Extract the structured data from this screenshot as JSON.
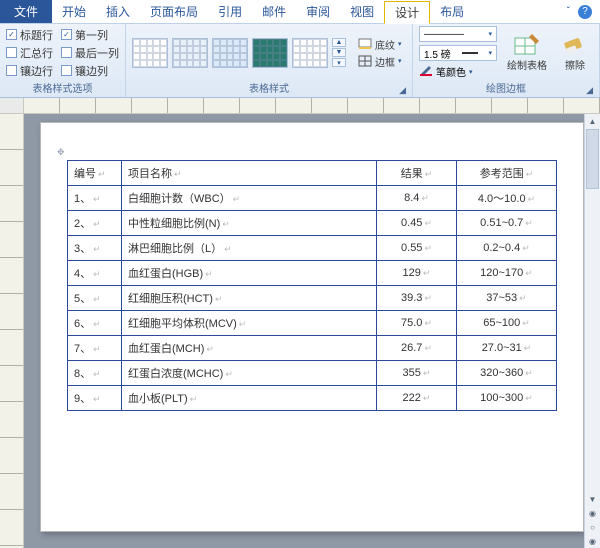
{
  "tabs": {
    "file": "文件",
    "items": [
      "开始",
      "插入",
      "页面布局",
      "引用",
      "邮件",
      "审阅",
      "视图",
      "设计",
      "布局"
    ],
    "active": "设计"
  },
  "help": {
    "caret": "ㅤ",
    "q": "?"
  },
  "group_options": {
    "label": "表格样式选项",
    "checks": [
      {
        "label": "标题行",
        "checked": true
      },
      {
        "label": "第一列",
        "checked": true
      },
      {
        "label": "汇总行",
        "checked": false
      },
      {
        "label": "最后一列",
        "checked": false
      },
      {
        "label": "镶边行",
        "checked": false
      },
      {
        "label": "镶边列",
        "checked": false
      }
    ]
  },
  "group_styles": {
    "label": "表格样式",
    "shading": "底纹",
    "border": "边框"
  },
  "group_border": {
    "label": "绘图边框",
    "line1": "————",
    "line2": "1.5 磅",
    "pen": "笔颜色",
    "draw": "绘制表格",
    "erase": "擦除"
  },
  "table": {
    "headers": [
      "编号",
      "项目名称",
      "结果",
      "参考范围"
    ],
    "rows": [
      {
        "idx": "1、",
        "name": "白细胞计数（WBC）",
        "res": "8.4",
        "ref": "4.0～10.0"
      },
      {
        "idx": "2、",
        "name": "中性粒细胞比例(N)",
        "res": "0.45",
        "ref": "0.51~0.7"
      },
      {
        "idx": "3、",
        "name": "淋巴细胞比例（L）",
        "res": "0.55",
        "ref": "0.2~0.4"
      },
      {
        "idx": "4、",
        "name": "血红蛋白(HGB)",
        "res": "129",
        "ref": "120~170"
      },
      {
        "idx": "5、",
        "name": "红细胞压积(HCT)",
        "res": "39.3",
        "ref": "37~53"
      },
      {
        "idx": "6、",
        "name": "红细胞平均体积(MCV)",
        "res": "75.0",
        "ref": "65~100"
      },
      {
        "idx": "7、",
        "name": "血红蛋白(MCH)",
        "res": "26.7",
        "ref": "27.0~31"
      },
      {
        "idx": "8、",
        "name": "红蛋白浓度(MCHC)",
        "res": "355",
        "ref": "320~360"
      },
      {
        "idx": "9、",
        "name": "血小板(PLT)",
        "res": "222",
        "ref": "100~300"
      }
    ]
  }
}
